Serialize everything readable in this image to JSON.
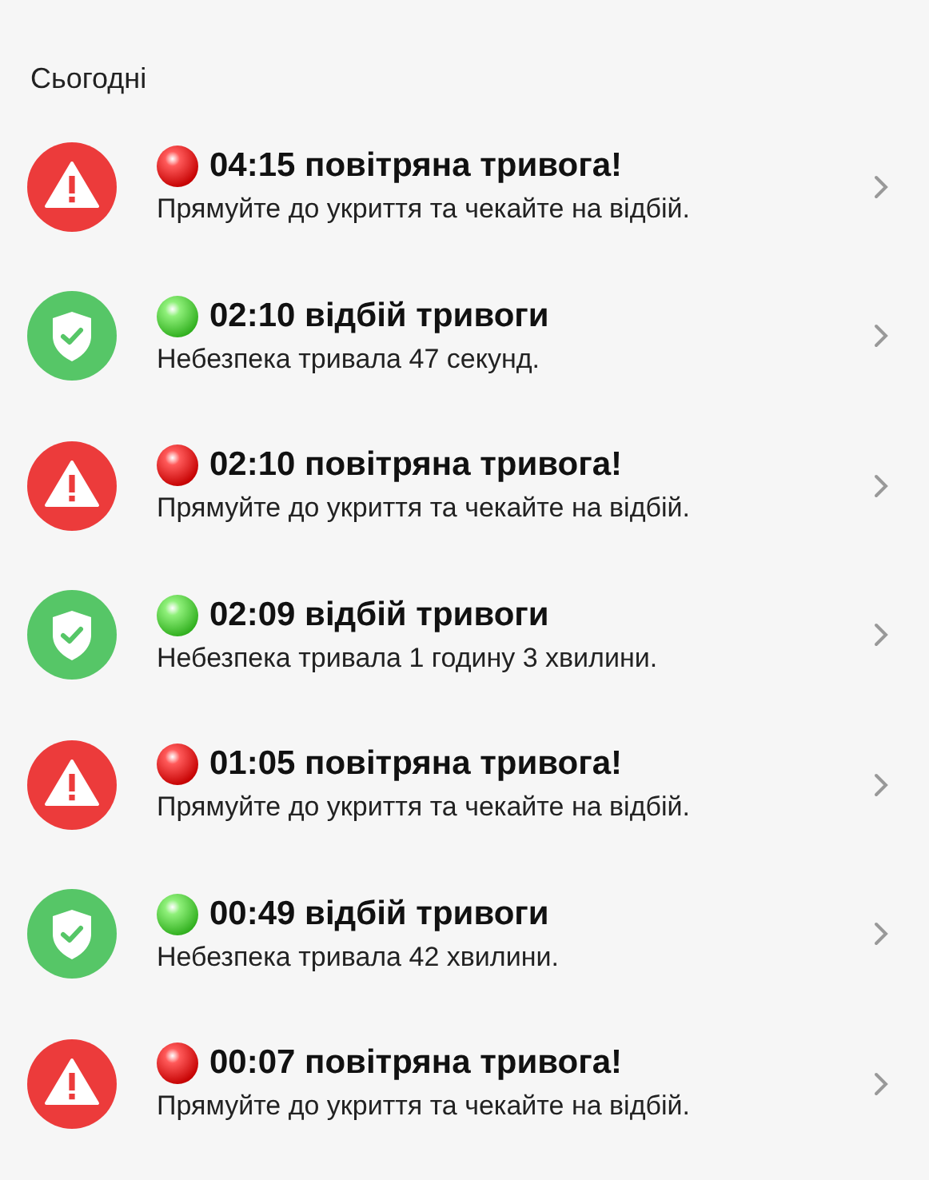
{
  "section_title": "Сьогодні",
  "events": [
    {
      "kind": "alert",
      "title": "04:15 повітряна тривога!",
      "message": "Прямуйте до укриття та чекайте на відбій."
    },
    {
      "kind": "clear",
      "title": "02:10 відбій тривоги",
      "message": "Небезпека тривала 47 секунд."
    },
    {
      "kind": "alert",
      "title": "02:10 повітряна тривога!",
      "message": "Прямуйте до укриття та чекайте на відбій."
    },
    {
      "kind": "clear",
      "title": "02:09 відбій тривоги",
      "message": "Небезпека тривала 1 годину 3 хвилини."
    },
    {
      "kind": "alert",
      "title": "01:05 повітряна тривога!",
      "message": "Прямуйте до укриття та чекайте на відбій."
    },
    {
      "kind": "clear",
      "title": "00:49 відбій тривоги",
      "message": "Небезпека тривала 42 хвилини."
    },
    {
      "kind": "alert",
      "title": "00:07 повітряна тривога!",
      "message": "Прямуйте до укриття та чекайте на відбій."
    }
  ]
}
